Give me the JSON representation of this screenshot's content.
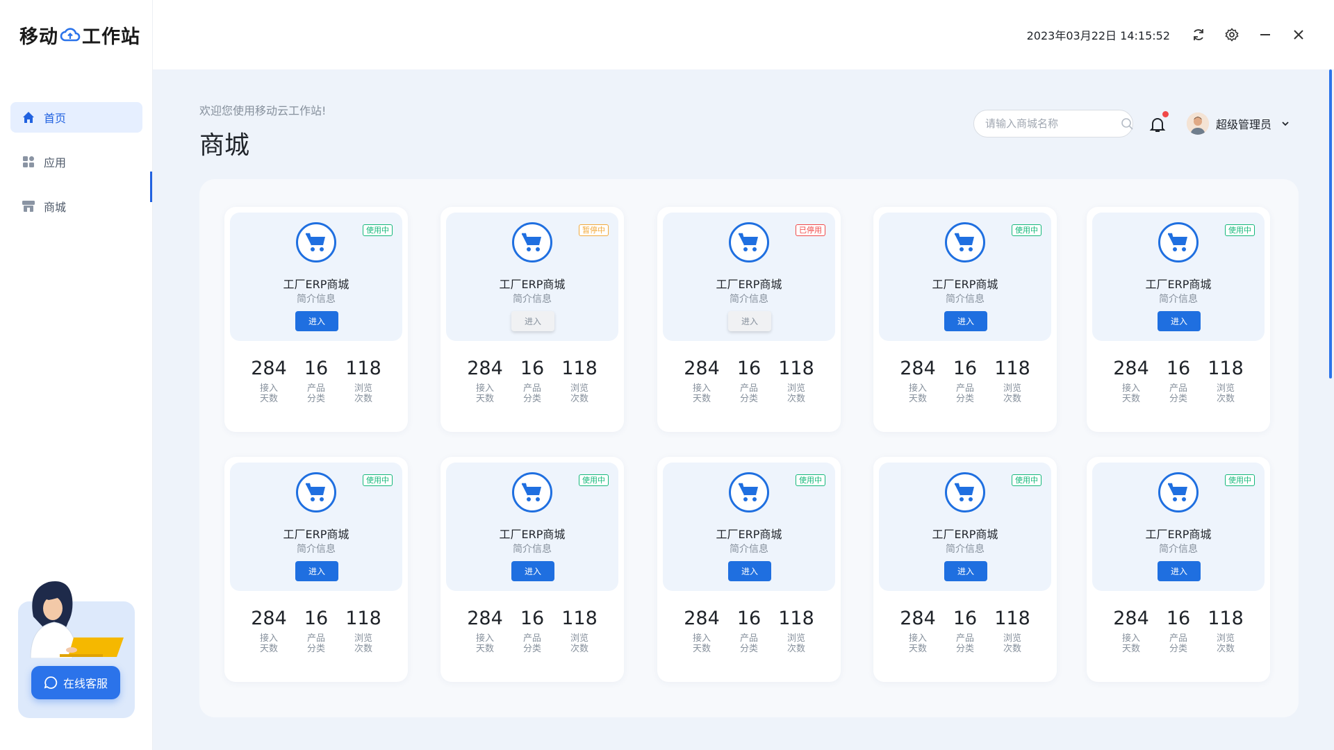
{
  "app": {
    "logo_left": "移动",
    "logo_right": "工作站",
    "datetime": "2023年03月22日 14:15:52"
  },
  "sidebar": {
    "items": [
      {
        "label": "首页",
        "icon": "home-icon",
        "active": true
      },
      {
        "label": "应用",
        "icon": "apps-icon",
        "active": false
      },
      {
        "label": "商城",
        "icon": "store-icon",
        "active": false
      }
    ],
    "support_label": "在线客服"
  },
  "header": {
    "welcome": "欢迎您使用移动云工作站!",
    "title": "商城",
    "search_placeholder": "请输入商城名称",
    "user_name": "超级管理员"
  },
  "colors": {
    "primary": "#1f6fe0",
    "active_badge": "#14b87a",
    "paused_badge": "#f2a93b",
    "disabled_badge": "#f04848"
  },
  "stat_labels": {
    "days": [
      "接入",
      "天数"
    ],
    "products": [
      "产品",
      "分类"
    ],
    "views": [
      "浏览",
      "次数"
    ]
  },
  "stores": [
    {
      "name": "工厂ERP商城",
      "desc": "简介信息",
      "status": "使用中",
      "status_type": "active",
      "enter": "进入",
      "enabled": true,
      "days": "284",
      "products": "16",
      "views": "118"
    },
    {
      "name": "工厂ERP商城",
      "desc": "简介信息",
      "status": "暂停中",
      "status_type": "paused",
      "enter": "进入",
      "enabled": false,
      "days": "284",
      "products": "16",
      "views": "118"
    },
    {
      "name": "工厂ERP商城",
      "desc": "简介信息",
      "status": "已停用",
      "status_type": "disabled",
      "enter": "进入",
      "enabled": false,
      "days": "284",
      "products": "16",
      "views": "118"
    },
    {
      "name": "工厂ERP商城",
      "desc": "简介信息",
      "status": "使用中",
      "status_type": "active",
      "enter": "进入",
      "enabled": true,
      "days": "284",
      "products": "16",
      "views": "118"
    },
    {
      "name": "工厂ERP商城",
      "desc": "简介信息",
      "status": "使用中",
      "status_type": "active",
      "enter": "进入",
      "enabled": true,
      "days": "284",
      "products": "16",
      "views": "118"
    },
    {
      "name": "工厂ERP商城",
      "desc": "简介信息",
      "status": "使用中",
      "status_type": "active",
      "enter": "进入",
      "enabled": true,
      "days": "284",
      "products": "16",
      "views": "118"
    },
    {
      "name": "工厂ERP商城",
      "desc": "简介信息",
      "status": "使用中",
      "status_type": "active",
      "enter": "进入",
      "enabled": true,
      "days": "284",
      "products": "16",
      "views": "118"
    },
    {
      "name": "工厂ERP商城",
      "desc": "简介信息",
      "status": "使用中",
      "status_type": "active",
      "enter": "进入",
      "enabled": true,
      "days": "284",
      "products": "16",
      "views": "118"
    },
    {
      "name": "工厂ERP商城",
      "desc": "简介信息",
      "status": "使用中",
      "status_type": "active",
      "enter": "进入",
      "enabled": true,
      "days": "284",
      "products": "16",
      "views": "118"
    },
    {
      "name": "工厂ERP商城",
      "desc": "简介信息",
      "status": "使用中",
      "status_type": "active",
      "enter": "进入",
      "enabled": true,
      "days": "284",
      "products": "16",
      "views": "118"
    }
  ]
}
